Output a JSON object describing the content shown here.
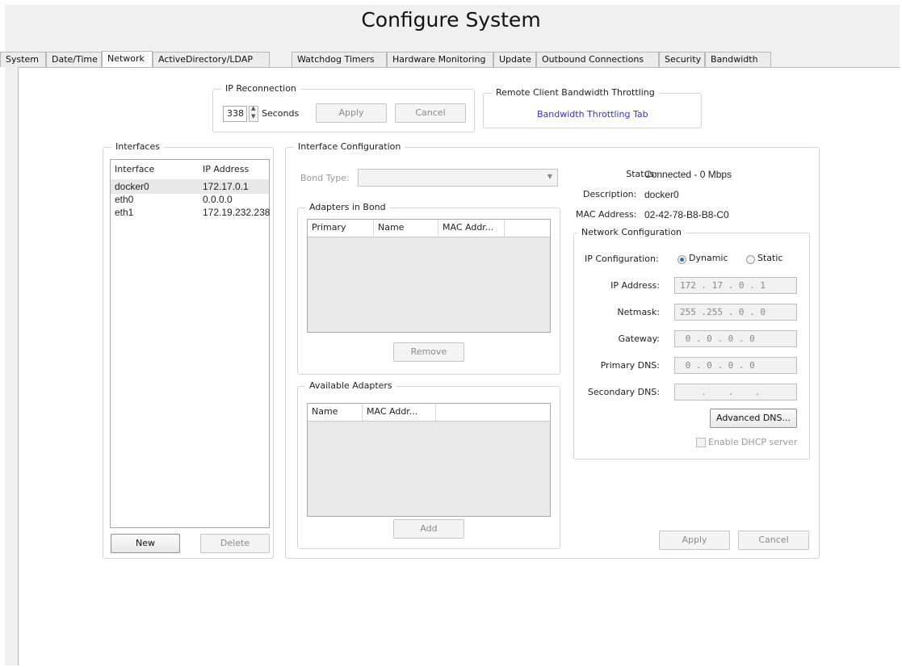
{
  "title": "Configure System",
  "tabs": [
    "System",
    "Date/Time",
    "Network",
    "ActiveDirectory/LDAP",
    "Watchdog Timers",
    "Hardware Monitoring",
    "Update",
    "Outbound Connections",
    "Security",
    "Bandwidth"
  ],
  "active_tab": "Network",
  "ip_reconnection": {
    "label": "IP Reconnection",
    "value": "338",
    "unit": "Seconds",
    "apply": "Apply",
    "cancel": "Cancel"
  },
  "bandwidth_throttling": {
    "label": "Remote Client Bandwidth Throttling",
    "link": "Bandwidth Throttling Tab"
  },
  "interfaces": {
    "label": "Interfaces",
    "columns": [
      "Interface",
      "IP Address"
    ],
    "rows": [
      {
        "name": "docker0",
        "ip": "172.17.0.1"
      },
      {
        "name": "eth0",
        "ip": "0.0.0.0"
      },
      {
        "name": "eth1",
        "ip": "172.19.232.238"
      }
    ],
    "new": "New",
    "delete": "Delete"
  },
  "interface_config": {
    "label": "Interface Configuration",
    "bond_type_label": "Bond Type:",
    "adapters_in_bond": {
      "label": "Adapters in Bond",
      "columns": [
        "Primary",
        "Name",
        "MAC Addr..."
      ],
      "remove": "Remove"
    },
    "available_adapters": {
      "label": "Available Adapters",
      "columns": [
        "Name",
        "MAC Addr..."
      ],
      "add": "Add"
    },
    "status_label": "Status:",
    "status_value": "Connected - 0 Mbps",
    "description_label": "Description:",
    "description_value": "docker0",
    "mac_label": "MAC Address:",
    "mac_value": "02-42-78-B8-B8-C0",
    "network_config": {
      "label": "Network Configuration",
      "ip_config_label": "IP Configuration:",
      "dynamic": "Dynamic",
      "static": "Static",
      "selected": "Dynamic",
      "fields": [
        {
          "label": "IP Address:",
          "value": "172 . 17 . 0 . 1"
        },
        {
          "label": "Netmask:",
          "value": "255 .255 . 0 . 0"
        },
        {
          "label": "Gateway:",
          "value": " 0 . 0 . 0 . 0"
        },
        {
          "label": "Primary DNS:",
          "value": " 0 . 0 . 0 . 0"
        },
        {
          "label": "Secondary DNS:",
          "value": "    .    .    ."
        }
      ],
      "advanced_dns": "Advanced DNS...",
      "enable_dhcp": "Enable DHCP server"
    },
    "apply": "Apply",
    "cancel": "Cancel"
  },
  "colors": {
    "link": "#3a2fd0",
    "selected_row": "#e8e8e8",
    "radio_selected": "#2f6fb5"
  }
}
